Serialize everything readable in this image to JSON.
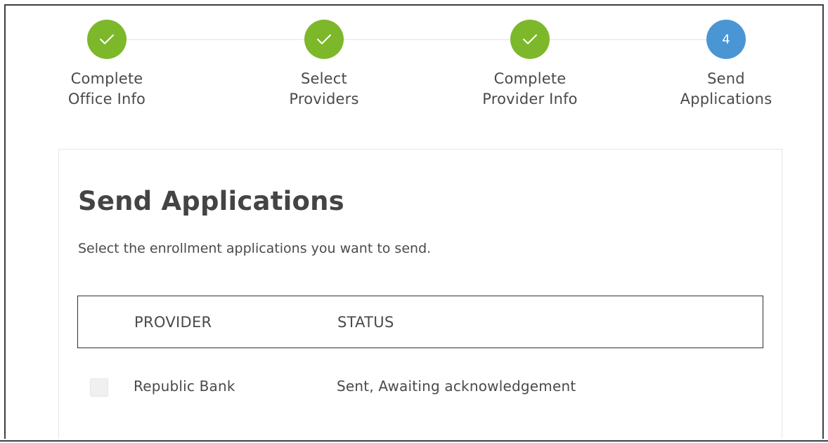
{
  "colors": {
    "completed_step": "#7cb82a",
    "current_step": "#4a96d4",
    "text": "#4a4a4a",
    "title": "#444444"
  },
  "stepper": {
    "steps": [
      {
        "label_line1": "Complete",
        "label_line2": "Office Info",
        "state": "completed",
        "icon": "checkmark-icon",
        "marker": ""
      },
      {
        "label_line1": "Select",
        "label_line2": "Providers",
        "state": "completed",
        "icon": "checkmark-icon",
        "marker": ""
      },
      {
        "label_line1": "Complete",
        "label_line2": "Provider Info",
        "state": "completed",
        "icon": "checkmark-icon",
        "marker": ""
      },
      {
        "label_line1": "Send",
        "label_line2": "Applications",
        "state": "current",
        "icon": "",
        "marker": "4"
      }
    ]
  },
  "card": {
    "title": "Send Applications",
    "subtitle": "Select the enrollment applications you want to send."
  },
  "table": {
    "headers": {
      "provider": "PROVIDER",
      "status": "STATUS"
    },
    "rows": [
      {
        "checked": false,
        "provider": "Republic Bank",
        "status": "Sent, Awaiting acknowledgement"
      }
    ]
  }
}
